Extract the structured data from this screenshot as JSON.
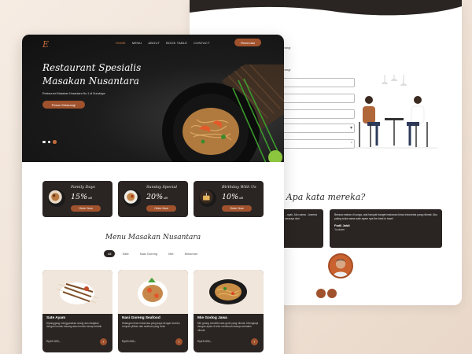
{
  "colors": {
    "accent": "#a0522d",
    "dark_card": "#2a2523",
    "page_bg": "#f3e8de"
  },
  "brand": {
    "logo_text": "E"
  },
  "nav": {
    "items": [
      "HOME",
      "MENU",
      "ABOUT",
      "BOOK TABLE",
      "CONTACT"
    ],
    "active_index": 0,
    "reservasi_label": "Reservasi"
  },
  "hero": {
    "title_line1": "Restaurant Spesialis",
    "title_line2": "Masakan Nusantara",
    "subtitle": "Restaurant Masakan Nusantara No.1 di Surabaya",
    "cta_label": "Pesan Sekarang!"
  },
  "promos": [
    {
      "name": "Family Days",
      "percent": "15%",
      "suffix": "off",
      "button": "Order Now",
      "icon": "family-plate-icon"
    },
    {
      "name": "Sunday Special",
      "percent": "20%",
      "suffix": "off",
      "button": "Order Now",
      "icon": "sunday-plate-icon"
    },
    {
      "name": "Birthday With Us",
      "percent": "10%",
      "suffix": "off",
      "button": "Order Now",
      "icon": "birthday-cake-icon"
    }
  ],
  "menu": {
    "title": "Menu Masakan Nusantara",
    "filters": [
      "All",
      "Sate",
      "Nasi Goreng",
      "Mie",
      "Minuman"
    ],
    "active_filter": 0,
    "items": [
      {
        "name": "Sate Ayam",
        "desc": "Dipanggang menggunakan arang dan disajikan dengan bumbu kacang atau bumbu kecap terbaik",
        "price": "Rp22.000,-",
        "icon": "sate-icon"
      },
      {
        "name": "Nasi Goreng Seafood",
        "desc": "Hidangan khas Indonesia yang kaya dengan bumbu rempah pilihan dan seafood yang fresh",
        "price": "Rp20.000,-",
        "icon": "nasi-goreng-icon"
      },
      {
        "name": "Mie Godog Jawa",
        "desc": "Mie godog memiliki rasa gurih yang nikmat. Ditengkapi dengan ayam & telur membuat rasanya semakin nikmat",
        "price": "Rp15.000,-",
        "icon": "mie-godog-icon"
      }
    ]
  },
  "back_form": {
    "label_1": "dorongi",
    "label_2": "dorongi"
  },
  "testimonials": {
    "title": "Apa kata mereka?",
    "cards": [
      {
        "text": "...nyak. Aku sama ...karena rasanya dari"
      },
      {
        "text": "Berasa makan di surga, ada banyak banget makanan khas Indonesia yang nikmat. Aku paling suka sama sate ayam nya the best in town!",
        "name": "Fadli Jaidi",
        "role": "Youtuber"
      }
    ]
  }
}
